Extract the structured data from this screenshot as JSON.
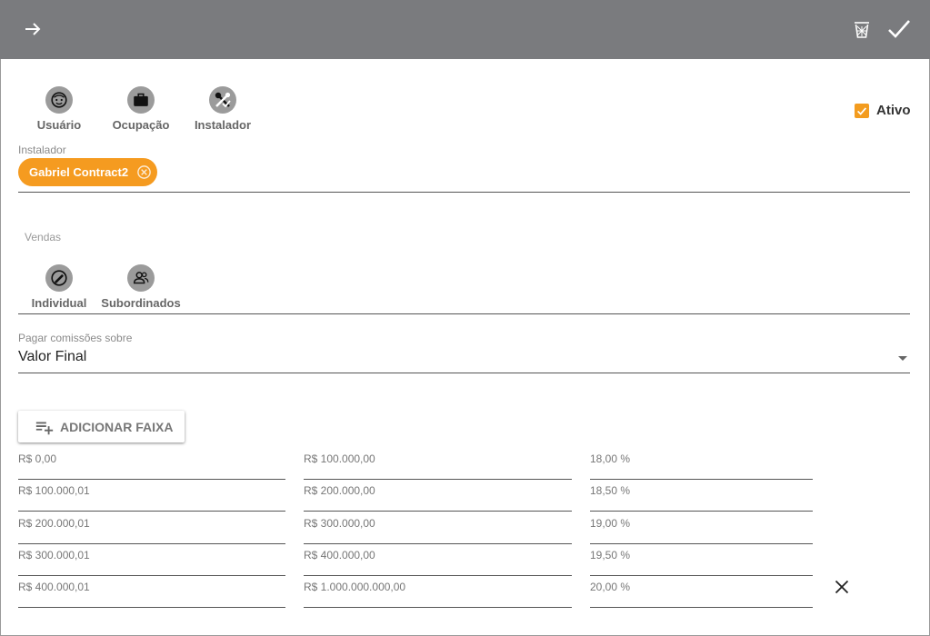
{
  "header": {
    "back_icon": "arrow-right-icon",
    "delete_icon": "trash-icon",
    "confirm_icon": "check-icon",
    "bar_color": "#7a7b7e"
  },
  "user_types": [
    {
      "label": "Usuário",
      "icon": "face-icon"
    },
    {
      "label": "Ocupação",
      "icon": "briefcase-icon"
    },
    {
      "label": "Instalador",
      "icon": "tools-icon"
    }
  ],
  "active": {
    "label": "Ativo",
    "checked": true,
    "color": "#f39c1f"
  },
  "installer": {
    "label": "Instalador",
    "chip": "Gabriel Contract2",
    "chip_color": "#f59b20"
  },
  "sales": {
    "label": "Vendas",
    "options": [
      {
        "label": "Individual",
        "icon": "person-edit-icon"
      },
      {
        "label": "Subordinados",
        "icon": "group-icon"
      }
    ]
  },
  "commission": {
    "label": "Pagar comissões sobre",
    "value": "Valor Final"
  },
  "add_range_label": "ADICIONAR FAIXA",
  "ranges": [
    {
      "from": "R$ 0,00",
      "to": "R$ 100.000,00",
      "percent": "18,00 %"
    },
    {
      "from": "R$ 100.000,01",
      "to": "R$ 200.000,00",
      "percent": "18,50 %"
    },
    {
      "from": "R$ 200.000,01",
      "to": "R$ 300.000,00",
      "percent": "19,00 %"
    },
    {
      "from": "R$ 300.000,01",
      "to": "R$ 400.000,00",
      "percent": "19,50 %"
    },
    {
      "from": "R$ 400.000,01",
      "to": "R$ 1.000.000.000,00",
      "percent": "20,00 %"
    }
  ]
}
